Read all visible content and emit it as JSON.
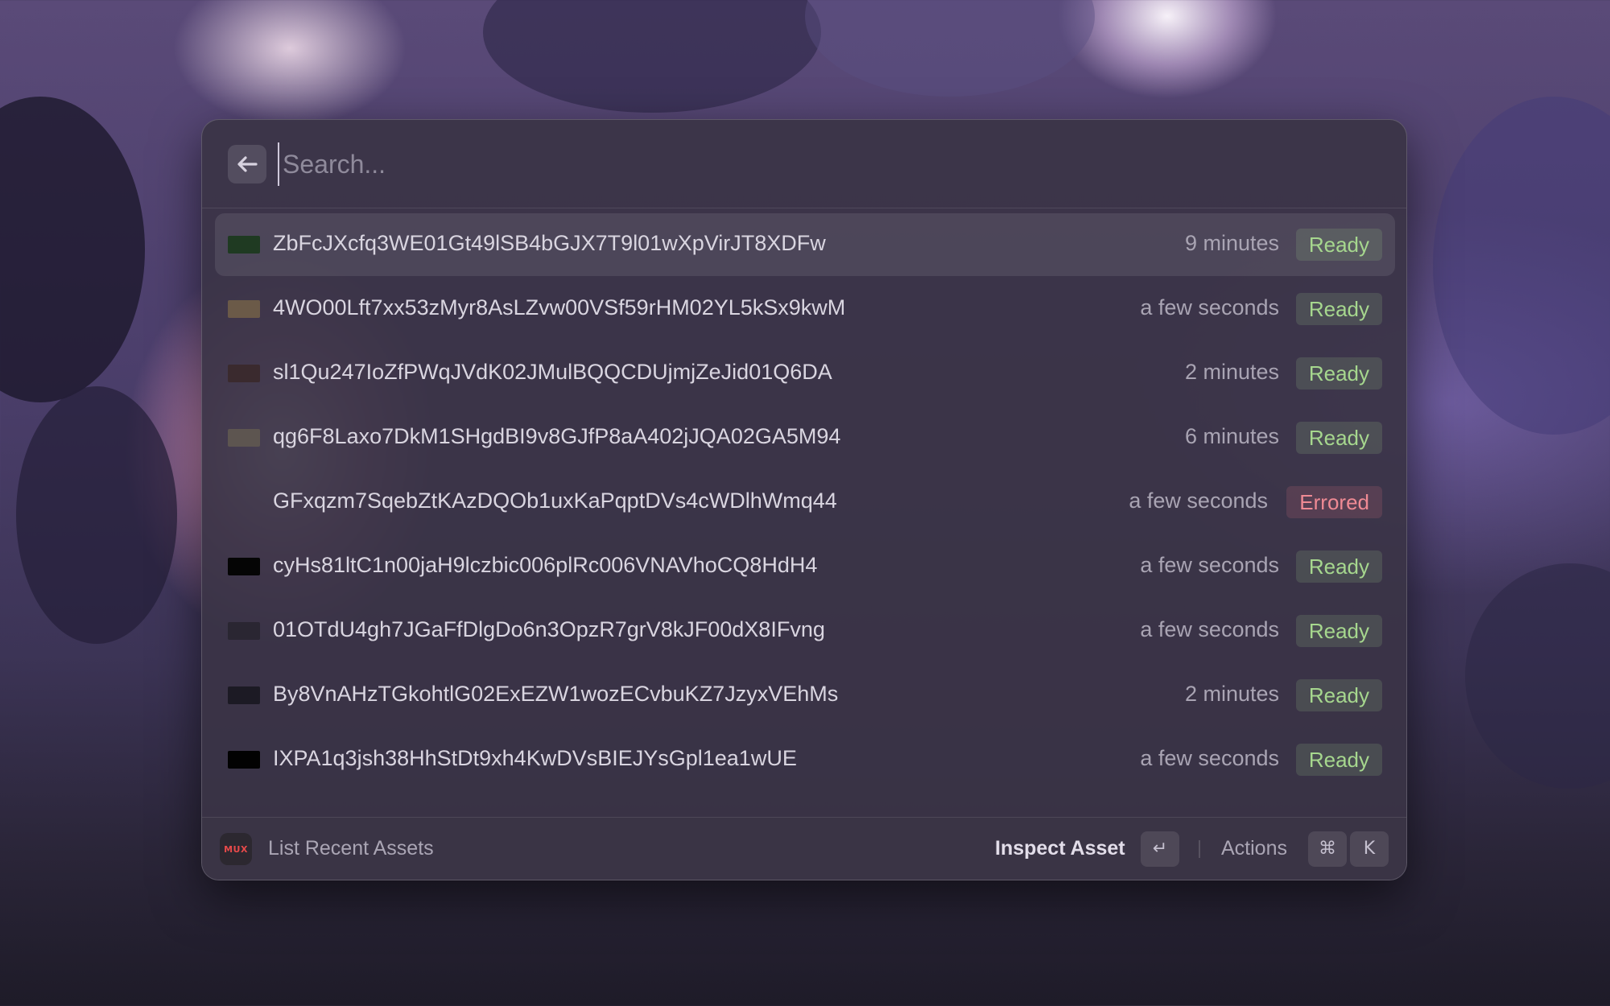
{
  "search": {
    "placeholder": "Search..."
  },
  "assets": [
    {
      "id": "ZbFcJXcfq3WE01Gt49lSB4bGJX7T9l01wXpVirJT8XDFw",
      "time": "9 minutes",
      "status": "Ready",
      "selected": true,
      "thumb": "#1f3a22"
    },
    {
      "id": "4WO00Lft7xx53zMyr8AsLZvw00VSf59rHM02YL5kSx9kwM",
      "time": "a few seconds",
      "status": "Ready",
      "selected": false,
      "thumb": "#6b5a48"
    },
    {
      "id": "sl1Qu247IoZfPWqJVdK02JMulBQQCDUjmjZeJid01Q6DA",
      "time": "2 minutes",
      "status": "Ready",
      "selected": false,
      "thumb": "#3a2a2e"
    },
    {
      "id": "qg6F8Laxo7DkM1SHgdBI9v8GJfP8aA402jJQA02GA5M94",
      "time": "6 minutes",
      "status": "Ready",
      "selected": false,
      "thumb": "#5d5550"
    },
    {
      "id": "GFxqzm7SqebZtKAzDQOb1uxKaPqptDVs4cWDlhWmq44",
      "time": "a few seconds",
      "status": "Errored",
      "selected": false,
      "thumb": ""
    },
    {
      "id": "cyHs81ltC1n00jaH9lczbic006plRc006VNAVhoCQ8HdH4",
      "time": "a few seconds",
      "status": "Ready",
      "selected": false,
      "thumb": "#050505"
    },
    {
      "id": "01OTdU4gh7JGaFfDlgDo6n3OpzR7grV8kJF00dX8IFvng",
      "time": "a few seconds",
      "status": "Ready",
      "selected": false,
      "thumb": "#2a2632"
    },
    {
      "id": "By8VnAHzTGkohtlG02ExEZW1wozECvbuKZ7JzyxVEhMs",
      "time": "2 minutes",
      "status": "Ready",
      "selected": false,
      "thumb": "#1c1a24"
    },
    {
      "id": "IXPA1q3jsh38HhStDt9xh4KwDVsBIEJYsGpl1ea1wUE",
      "time": "a few seconds",
      "status": "Ready",
      "selected": false,
      "thumb": "#020202"
    }
  ],
  "footer": {
    "logo_text": "MUX",
    "title": "List Recent Assets",
    "primary_action": "Inspect Asset",
    "enter_key": "↵",
    "secondary_action": "Actions",
    "cmd_key": "⌘",
    "k_key": "K"
  },
  "colors": {
    "ready": "#a6d78e",
    "errored": "#ef8a94",
    "accent_logo": "#e84a4a"
  }
}
